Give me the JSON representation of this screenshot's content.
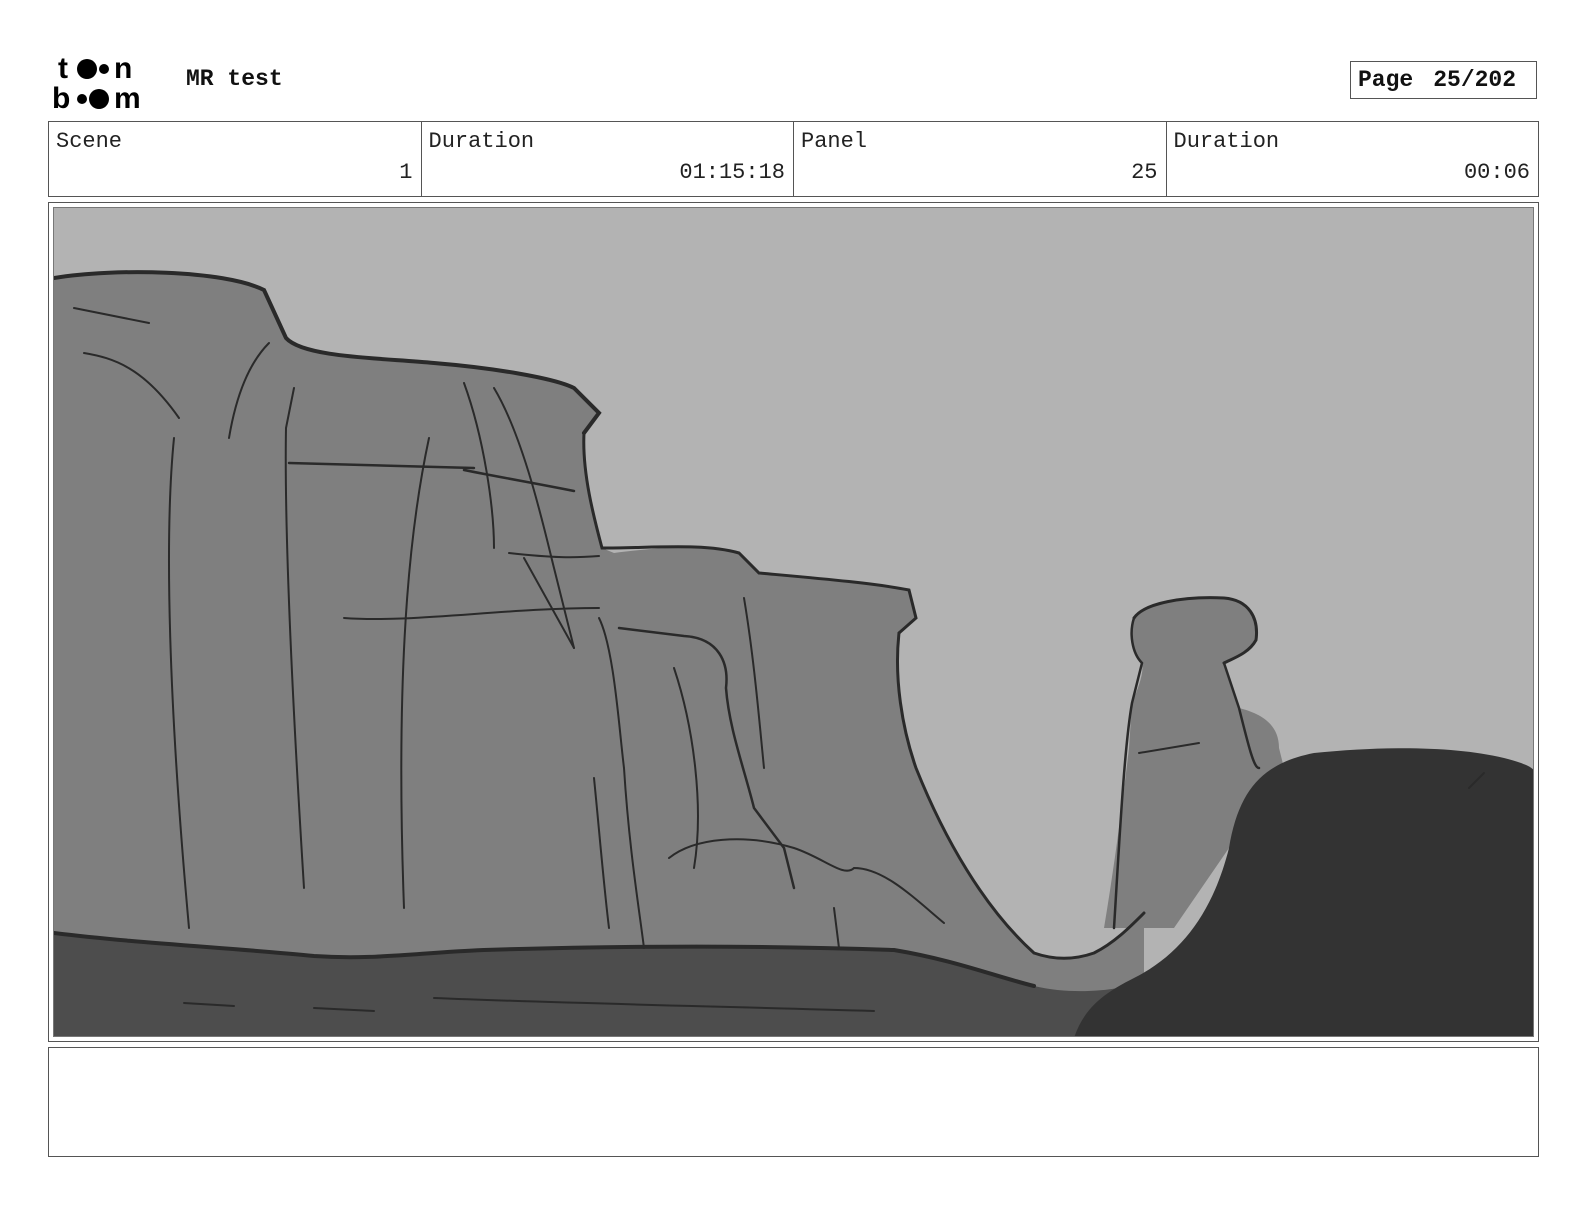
{
  "header": {
    "logo_text": "toon boom",
    "project_title": "MR test",
    "page_label": "Page",
    "page_number": "25/202"
  },
  "info": [
    {
      "label": "Scene",
      "value": "1"
    },
    {
      "label": "Duration",
      "value": "01:15:18"
    },
    {
      "label": "Panel",
      "value": "25"
    },
    {
      "label": "Duration",
      "value": "00:06"
    }
  ],
  "panel": {
    "palette": {
      "sky": "#b3b3b3",
      "cliff": "#7f7f7f",
      "ground": "#4d4d4d",
      "boulder": "#333333",
      "line": "#2a2a2a"
    }
  },
  "notes": {
    "text": ""
  }
}
